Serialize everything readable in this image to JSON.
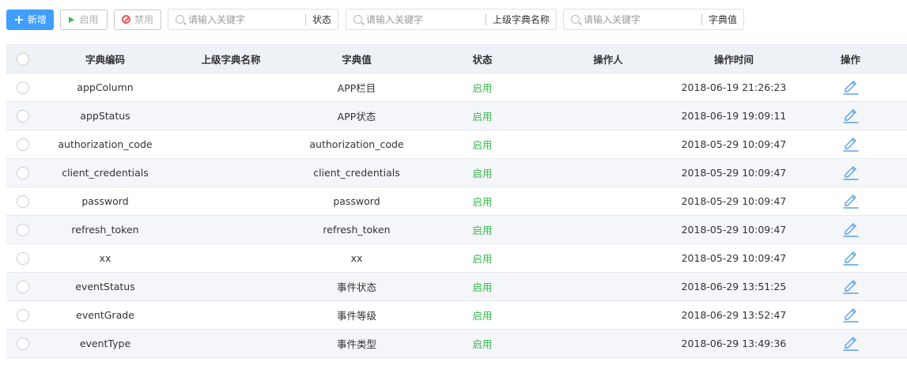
{
  "toolbar": {
    "add_label": "新增",
    "enable_label": "启用",
    "disable_label": "禁用"
  },
  "filters": [
    {
      "placeholder": "请输入关键字",
      "label": "状态"
    },
    {
      "placeholder": "请输入关键字",
      "label": "上级字典名称"
    },
    {
      "placeholder": "请输入关键字",
      "label": "字典值"
    }
  ],
  "table": {
    "columns": [
      "字典编码",
      "上级字典名称",
      "字典值",
      "状态",
      "操作人",
      "操作时间",
      "操作"
    ],
    "rows": [
      {
        "code": "appColumn",
        "parent": "",
        "value": "APP栏目",
        "status": "启用",
        "operator": "",
        "time": "2018-06-19 21:26:23"
      },
      {
        "code": "appStatus",
        "parent": "",
        "value": "APP状态",
        "status": "启用",
        "operator": "",
        "time": "2018-06-19 19:09:11"
      },
      {
        "code": "authorization_code",
        "parent": "",
        "value": "authorization_code",
        "status": "启用",
        "operator": "",
        "time": "2018-05-29 10:09:47"
      },
      {
        "code": "client_credentials",
        "parent": "",
        "value": "client_credentials",
        "status": "启用",
        "operator": "",
        "time": "2018-05-29 10:09:47"
      },
      {
        "code": "password",
        "parent": "",
        "value": "password",
        "status": "启用",
        "operator": "",
        "time": "2018-05-29 10:09:47"
      },
      {
        "code": "refresh_token",
        "parent": "",
        "value": "refresh_token",
        "status": "启用",
        "operator": "",
        "time": "2018-05-29 10:09:47"
      },
      {
        "code": "xx",
        "parent": "",
        "value": "xx",
        "status": "启用",
        "operator": "",
        "time": "2018-05-29 10:09:47"
      },
      {
        "code": "eventStatus",
        "parent": "",
        "value": "事件状态",
        "status": "启用",
        "operator": "",
        "time": "2018-06-29 13:51:25"
      },
      {
        "code": "eventGrade",
        "parent": "",
        "value": "事件等级",
        "status": "启用",
        "operator": "",
        "time": "2018-06-29 13:52:47"
      },
      {
        "code": "eventType",
        "parent": "",
        "value": "事件类型",
        "status": "启用",
        "operator": "",
        "time": "2018-06-29 13:49:36"
      }
    ]
  },
  "colors": {
    "primary": "#409eff",
    "enabled": "#38b84e",
    "danger": "#f25555",
    "header_bg": "#eef1f6",
    "stripe_bg": "#f4f6f9",
    "edit_icon": "#5aa0ea"
  }
}
